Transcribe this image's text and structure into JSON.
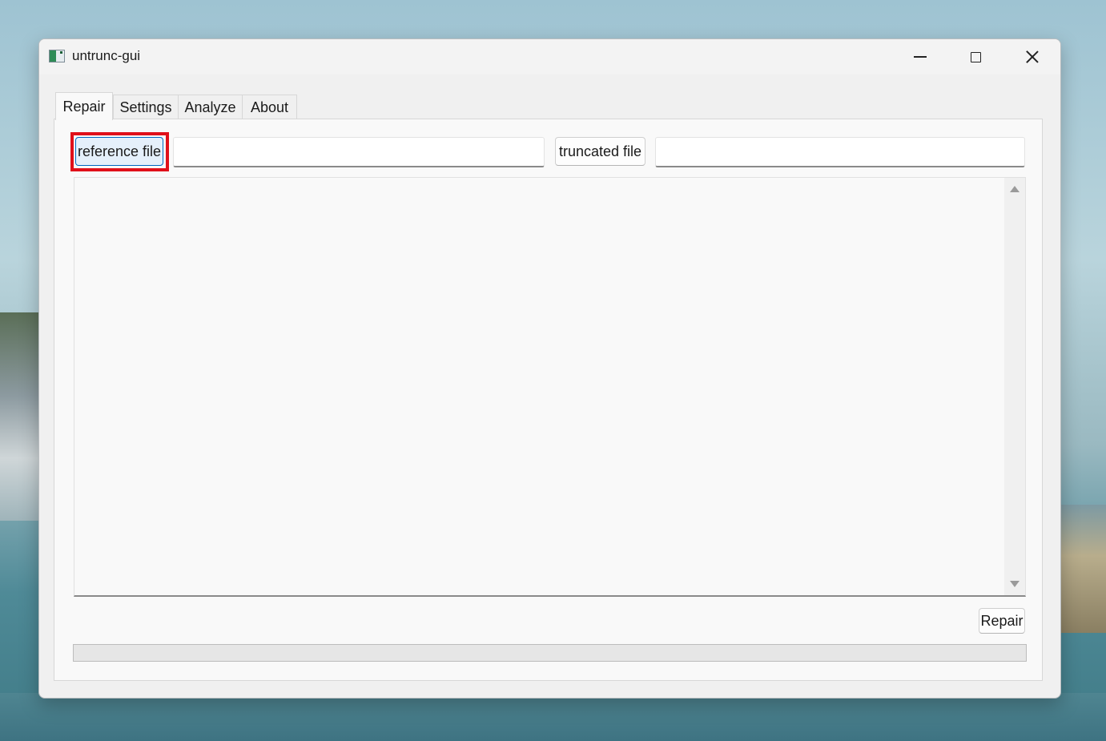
{
  "window": {
    "title": "untrunc-gui",
    "controls": [
      "minimize",
      "maximize",
      "close"
    ]
  },
  "tabs": [
    {
      "label": "Repair",
      "active": true
    },
    {
      "label": "Settings",
      "active": false
    },
    {
      "label": "Analyze",
      "active": false
    },
    {
      "label": "About",
      "active": false
    }
  ],
  "repair": {
    "reference_button": "reference file",
    "reference_value": "",
    "truncated_button": "truncated file",
    "truncated_value": "",
    "log_text": "",
    "repair_button": "Repair",
    "progress": 0
  },
  "colors": {
    "highlight": "#e0101a",
    "focus_border": "#0067c0",
    "progress_fill": "#06b025"
  },
  "icons": {
    "app": "app-icon",
    "minimize": "minimize-icon",
    "maximize": "maximize-icon",
    "close": "close-icon",
    "scroll_up": "scroll-up-arrow-icon",
    "scroll_down": "scroll-down-arrow-icon"
  }
}
